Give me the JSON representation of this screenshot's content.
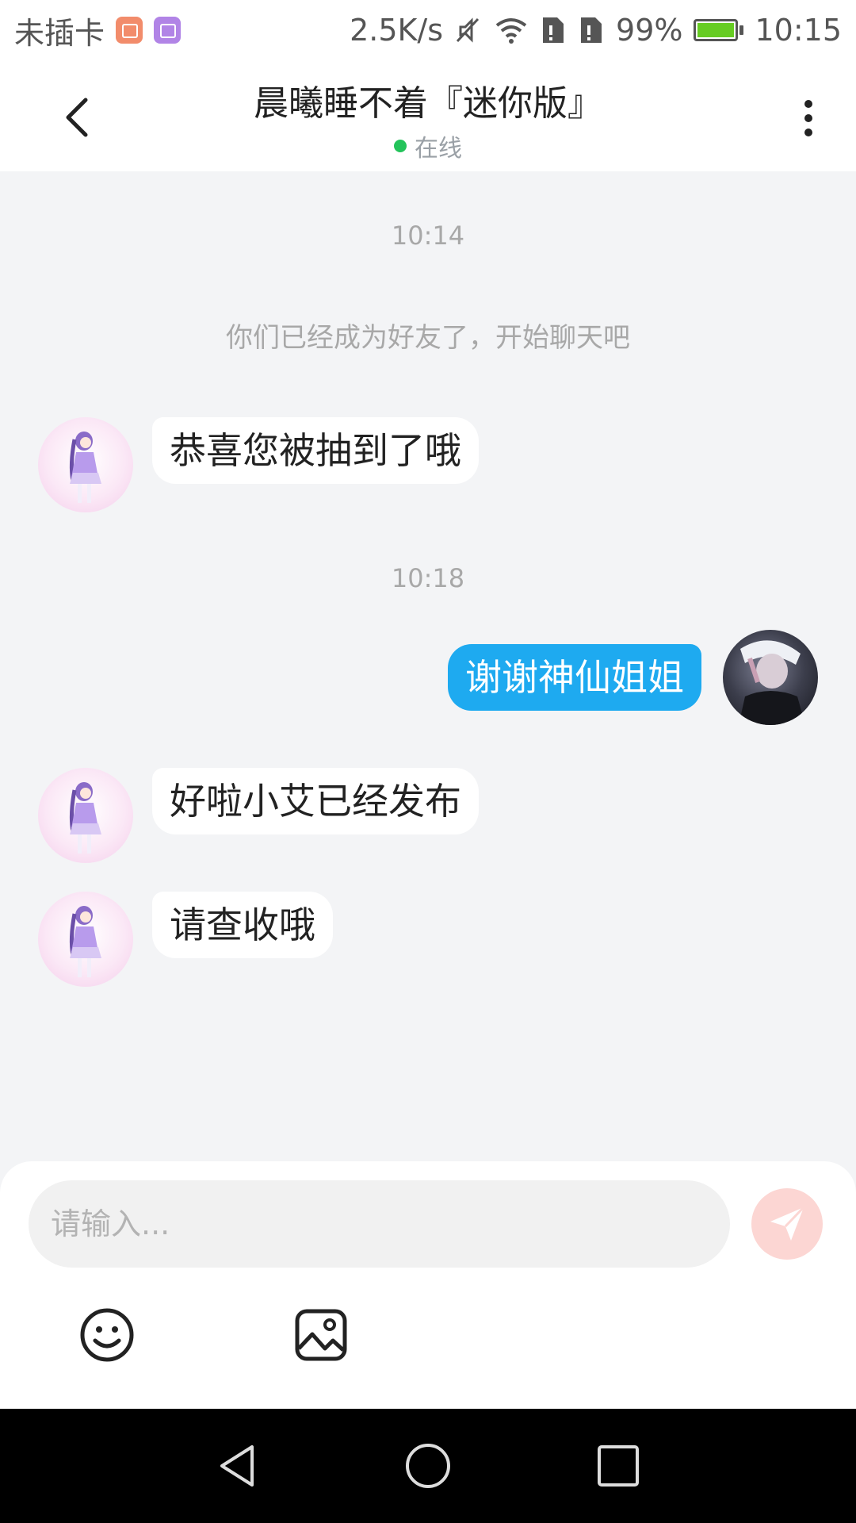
{
  "status_bar": {
    "carrier": "未插卡",
    "net_speed": "2.5K/s",
    "battery_percent": "99%",
    "battery_level": 0.99,
    "time": "10:15",
    "icons": [
      "mail-app-icon",
      "gallery-app-icon",
      "mute-icon",
      "wifi-icon",
      "sim-icon",
      "sim-icon",
      "battery-charging-icon"
    ]
  },
  "header": {
    "title": "晨曦睡不着『迷你版』",
    "status": "在线",
    "status_color": "#23c35a"
  },
  "chat": {
    "timestamps": [
      "10:14",
      "10:18"
    ],
    "system_message": "你们已经成为好友了，开始聊天吧",
    "messages": [
      {
        "from": "other",
        "text": "恭喜您被抽到了哦"
      },
      {
        "from": "me",
        "text": "谢谢神仙姐姐"
      },
      {
        "from": "other",
        "text": "好啦小艾已经发布"
      },
      {
        "from": "other",
        "text": "请查收哦"
      }
    ]
  },
  "input": {
    "placeholder": "请输入...",
    "value": ""
  },
  "colors": {
    "accent_bubble": "#1eaaf0",
    "send_button": "#fcd6d3",
    "background": "#f3f4f6"
  }
}
